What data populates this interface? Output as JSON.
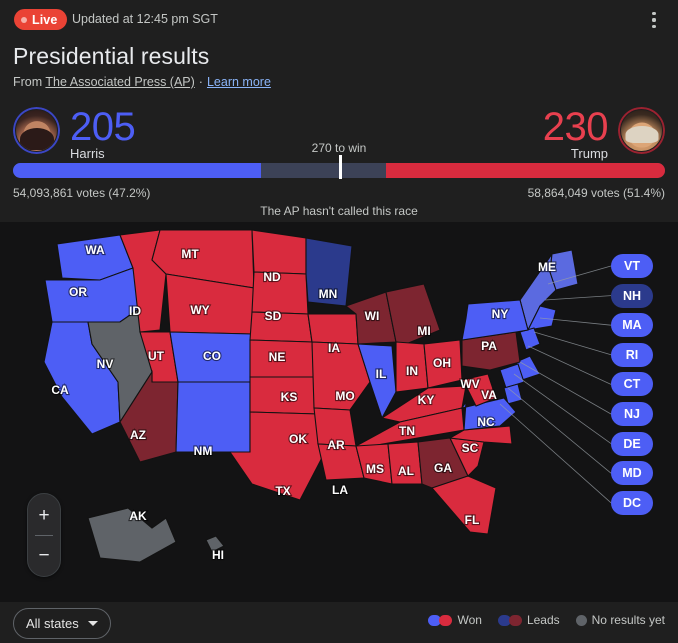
{
  "header": {
    "live_label": "Live",
    "updated": "Updated at 12:45 pm SGT",
    "menu_icon": "kebab-menu-icon",
    "title": "Presidential results",
    "from_prefix": "From",
    "source": "The Associated Press (AP)",
    "separator": "·",
    "learn_more": "Learn more"
  },
  "race": {
    "threshold_label": "270 to win",
    "called_status": "The AP hasn't called this race",
    "left": {
      "electoral_votes": "205",
      "name": "Harris",
      "votes_text": "54,093,861 votes (47.2%)",
      "percent": 47.2,
      "color": "#4d5ef5"
    },
    "right": {
      "electoral_votes": "230",
      "name": "Trump",
      "votes_text": "58,864,049 votes (51.4%)",
      "percent": 51.4,
      "color": "#d92b3e"
    }
  },
  "map": {
    "pills": [
      {
        "code": "VT",
        "status": "won-d"
      },
      {
        "code": "NH",
        "status": "lead-d"
      },
      {
        "code": "MA",
        "status": "won-d"
      },
      {
        "code": "RI",
        "status": "won-d"
      },
      {
        "code": "CT",
        "status": "won-d"
      },
      {
        "code": "NJ",
        "status": "won-d"
      },
      {
        "code": "DE",
        "status": "won-d"
      },
      {
        "code": "MD",
        "status": "won-d"
      },
      {
        "code": "DC",
        "status": "won-d"
      }
    ],
    "states": [
      {
        "code": "WA",
        "status": "won-d"
      },
      {
        "code": "OR",
        "status": "won-d"
      },
      {
        "code": "CA",
        "status": "won-d"
      },
      {
        "code": "NV",
        "status": "none"
      },
      {
        "code": "ID",
        "status": "won-r"
      },
      {
        "code": "MT",
        "status": "won-r"
      },
      {
        "code": "WY",
        "status": "won-r"
      },
      {
        "code": "UT",
        "status": "won-r"
      },
      {
        "code": "AZ",
        "status": "lead-r"
      },
      {
        "code": "NM",
        "status": "won-d"
      },
      {
        "code": "CO",
        "status": "won-d"
      },
      {
        "code": "ND",
        "status": "won-r"
      },
      {
        "code": "SD",
        "status": "won-r"
      },
      {
        "code": "NE",
        "status": "won-r"
      },
      {
        "code": "KS",
        "status": "won-r"
      },
      {
        "code": "OK",
        "status": "won-r"
      },
      {
        "code": "TX",
        "status": "won-r"
      },
      {
        "code": "MN",
        "status": "lead-d"
      },
      {
        "code": "IA",
        "status": "won-r"
      },
      {
        "code": "MO",
        "status": "won-r"
      },
      {
        "code": "AR",
        "status": "won-r"
      },
      {
        "code": "LA",
        "status": "won-r"
      },
      {
        "code": "WI",
        "status": "lead-r"
      },
      {
        "code": "IL",
        "status": "won-d"
      },
      {
        "code": "MI",
        "status": "lead-r"
      },
      {
        "code": "IN",
        "status": "won-r"
      },
      {
        "code": "OH",
        "status": "won-r"
      },
      {
        "code": "KY",
        "status": "won-r"
      },
      {
        "code": "TN",
        "status": "won-r"
      },
      {
        "code": "MS",
        "status": "won-r"
      },
      {
        "code": "AL",
        "status": "won-r"
      },
      {
        "code": "GA",
        "status": "lead-r"
      },
      {
        "code": "FL",
        "status": "won-r"
      },
      {
        "code": "SC",
        "status": "won-r"
      },
      {
        "code": "NC",
        "status": "won-r"
      },
      {
        "code": "VA",
        "status": "won-d"
      },
      {
        "code": "WV",
        "status": "won-r"
      },
      {
        "code": "PA",
        "status": "lead-r"
      },
      {
        "code": "NY",
        "status": "won-d"
      },
      {
        "code": "ME",
        "status": "med-d"
      },
      {
        "code": "AK",
        "status": "none"
      },
      {
        "code": "HI",
        "status": "none"
      }
    ]
  },
  "controls": {
    "zoom_in": "+",
    "zoom_out": "−",
    "state_filter": "All states"
  },
  "legend": [
    {
      "label": "Won",
      "kind": "pair-bright"
    },
    {
      "label": "Leads",
      "kind": "pair-dark"
    },
    {
      "label": "No results yet",
      "kind": "single-gray"
    }
  ]
}
